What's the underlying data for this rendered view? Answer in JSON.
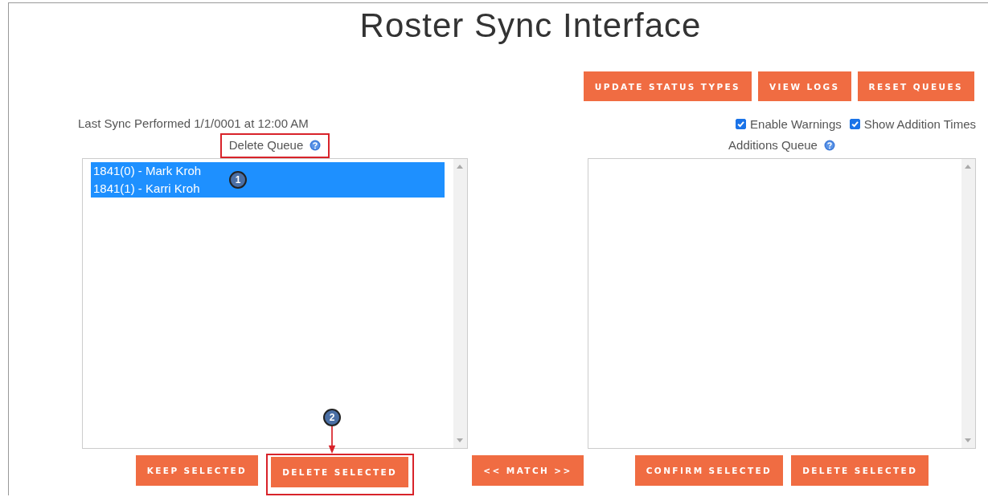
{
  "title": "Roster Sync Interface",
  "toolbar_buttons": [
    "UPDATE STATUS TYPES",
    "VIEW LOGS",
    "RESET QUEUES"
  ],
  "last_sync": "Last Sync Performed 1/1/0001 at 12:00 AM",
  "options": [
    {
      "label": "Enable Warnings",
      "checked": true
    },
    {
      "label": "Show Addition Times",
      "checked": true
    }
  ],
  "delete_queue": {
    "title": "Delete Queue",
    "highlighted": true,
    "items": [
      {
        "label": "1841(0) - Mark Kroh",
        "selected": true
      },
      {
        "label": "1841(1) - Karri Kroh",
        "selected": true
      }
    ],
    "buttons": [
      {
        "label": "KEEP SELECTED",
        "highlighted": false
      },
      {
        "label": "DELETE SELECTED",
        "highlighted": true
      }
    ]
  },
  "match_button": "<< MATCH >>",
  "additions_queue": {
    "title": "Additions Queue",
    "highlighted": false,
    "buttons": [
      {
        "label": "CONFIRM SELECTED",
        "highlighted": false
      },
      {
        "label": "DELETE SELECTED",
        "highlighted": false
      }
    ]
  },
  "annotations": [
    {
      "number": "1"
    },
    {
      "number": "2"
    }
  ]
}
